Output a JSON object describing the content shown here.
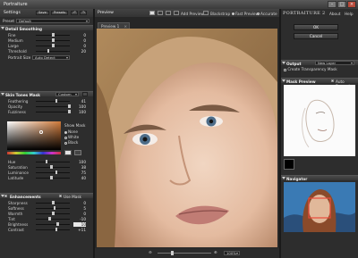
{
  "app": {
    "title": "Portraiture"
  },
  "left": {
    "settings": "Settings",
    "save": "Save",
    "presets": "Presets",
    "preset_label": "Preset",
    "preset_value": "Default",
    "detail": {
      "title": "Detail Smoothing",
      "rows": [
        {
          "label": "Fine",
          "value": "0",
          "pct": 0.5
        },
        {
          "label": "Medium",
          "value": "0",
          "pct": 0.5
        },
        {
          "label": "Large",
          "value": "0",
          "pct": 0.5
        },
        {
          "label": "Threshold",
          "value": "20",
          "pct": 0.35
        }
      ],
      "portrait_size_label": "Portrait Size",
      "portrait_size_value": "Auto Detect"
    },
    "skin": {
      "title": "Skin Tones Mask",
      "mode": "Custom",
      "rows": [
        {
          "label": "Feathering",
          "value": "41",
          "pct": 0.6
        },
        {
          "label": "Opacity",
          "value": "100",
          "pct": 1.0
        },
        {
          "label": "Fuzziness",
          "value": "100",
          "pct": 1.0
        }
      ],
      "show_mask": "Show Mask",
      "show_opts": [
        "None",
        "White",
        "Black"
      ],
      "rows2": [
        {
          "label": "Hue",
          "value": "100",
          "pct": 0.3
        },
        {
          "label": "Saturation",
          "value": "38",
          "pct": 0.45
        },
        {
          "label": "Luminance",
          "value": "75",
          "pct": 0.6
        },
        {
          "label": "Latitude",
          "value": "40",
          "pct": 0.45
        }
      ]
    },
    "enh": {
      "title": "Enhancements",
      "use_mask": "Use Mask",
      "rows": [
        {
          "label": "Sharpness",
          "value": "0",
          "pct": 0.5,
          "box": false
        },
        {
          "label": "Softness",
          "value": "5",
          "pct": 0.55,
          "box": false
        },
        {
          "label": "Warmth",
          "value": "0",
          "pct": 0.5,
          "box": false
        },
        {
          "label": "Tint",
          "value": "-10",
          "pct": 0.4,
          "box": false
        },
        {
          "label": "Brightness",
          "value": "10",
          "pct": 0.65,
          "box": true
        },
        {
          "label": "Contrast",
          "value": "+11",
          "pct": 0.6,
          "box": false
        }
      ]
    }
  },
  "center": {
    "preview": "Preview",
    "add_preview": "Add Preview",
    "blackstrap": "Blackstrap",
    "fast_preview": "Fast Preview",
    "accurate": "Accurate",
    "tab": "Preview 1",
    "zoom": "100%"
  },
  "right": {
    "brand": "PORTRAITURE 2",
    "about": "About",
    "help": "Help",
    "ok": "OK",
    "cancel": "Cancel",
    "output": "Output",
    "output_value": "New Layer",
    "create_mask": "Create Transparency Mask",
    "mask_preview": "Mask Preview",
    "auto_expand": "Auto Expand",
    "navigator": "Navigator"
  },
  "colors": {
    "bg": "#2d2d2d",
    "accent": "#8fa8c8"
  }
}
